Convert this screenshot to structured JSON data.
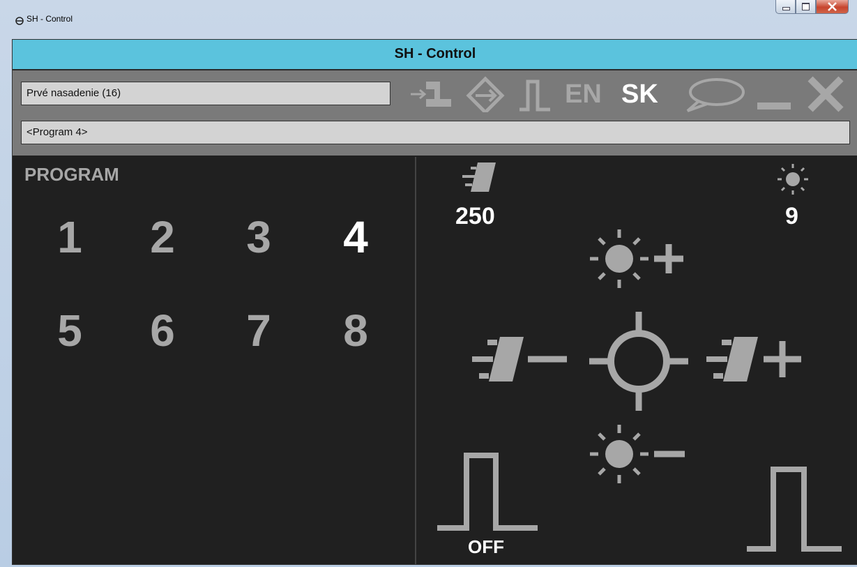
{
  "window": {
    "title": "SH - Control",
    "buttons": [
      "minimize",
      "maximize",
      "close"
    ]
  },
  "header": {
    "title": "SH - Control"
  },
  "toolbar": {
    "device_field": "Prvé nasadenie (16)",
    "program_field": "<Program 4>",
    "icons": [
      "connect-icon",
      "direction-icon",
      "pulse-icon",
      "chat-icon",
      "minimize-icon",
      "close-icon"
    ],
    "lang_en": "EN",
    "lang_sk": "SK"
  },
  "program": {
    "title": "PROGRAM",
    "numbers": [
      "1",
      "2",
      "3",
      "4",
      "5",
      "6",
      "7",
      "8"
    ],
    "selected": "4"
  },
  "controls": {
    "speed_value": "250",
    "brightness_value": "9",
    "pulse_left_label": "OFF",
    "icons": [
      "speed-icon",
      "brightness-icon",
      "brightness-plus-icon",
      "speed-minus-icon",
      "center-target-icon",
      "speed-plus-icon",
      "brightness-minus-icon",
      "pulse-off-icon",
      "pulse-icon"
    ]
  },
  "colors": {
    "header_bg": "#5bc3dd",
    "panel_bg": "#202020",
    "toolbar_bg": "#7a7a7a",
    "icon_gray": "#a7a7a7",
    "highlight": "#ffffff"
  }
}
